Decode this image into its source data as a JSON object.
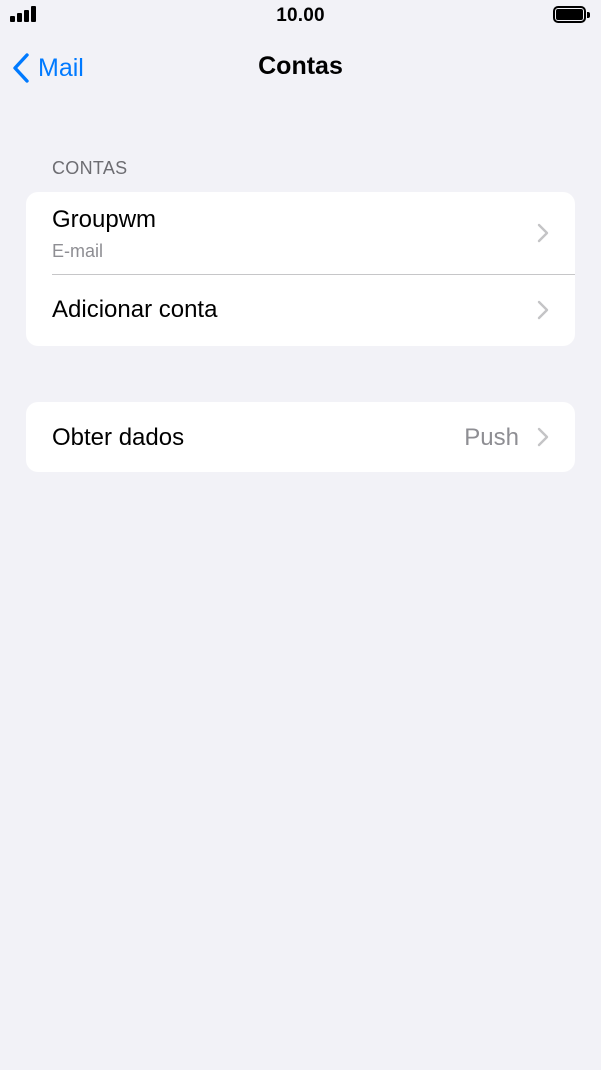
{
  "status_bar": {
    "time": "10.00",
    "signal_icon": "cellular-signal-icon",
    "battery_icon": "battery-full-icon"
  },
  "nav": {
    "back_label": "Mail",
    "back_icon": "chevron-left-icon",
    "title": "Contas"
  },
  "accounts_section": {
    "header": "CONTAS",
    "items": [
      {
        "title": "Groupwm",
        "subtitle": "E-mail"
      },
      {
        "title": "Adicionar conta"
      }
    ]
  },
  "fetch_section": {
    "title": "Obter dados",
    "value": "Push"
  },
  "colors": {
    "background": "#F2F2F7",
    "accent": "#007AFF",
    "secondary_text": "#8E8E93",
    "chevron": "#C4C4C6"
  }
}
